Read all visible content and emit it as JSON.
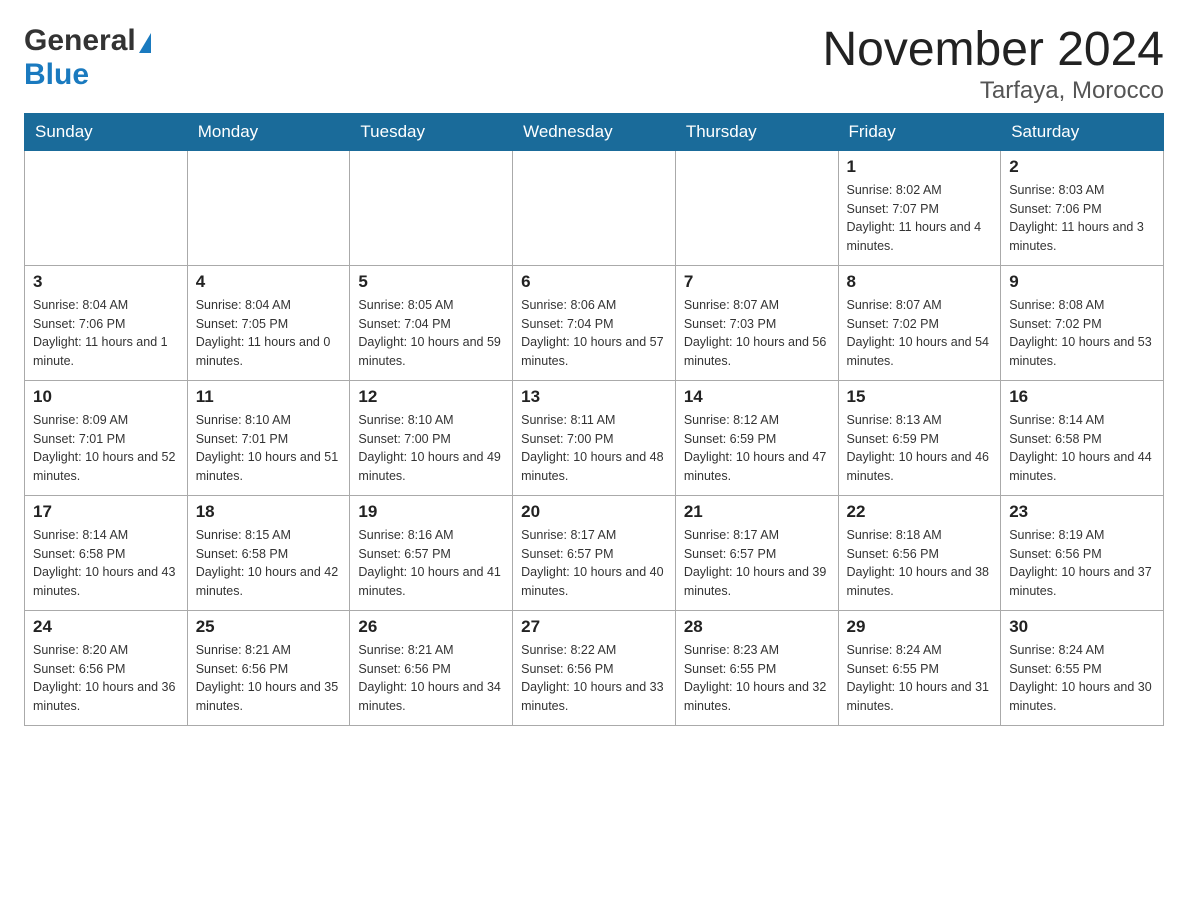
{
  "logo": {
    "general": "General",
    "blue": "Blue"
  },
  "title": {
    "month_year": "November 2024",
    "location": "Tarfaya, Morocco"
  },
  "weekdays": [
    "Sunday",
    "Monday",
    "Tuesday",
    "Wednesday",
    "Thursday",
    "Friday",
    "Saturday"
  ],
  "weeks": [
    {
      "days": [
        {
          "number": "",
          "info": ""
        },
        {
          "number": "",
          "info": ""
        },
        {
          "number": "",
          "info": ""
        },
        {
          "number": "",
          "info": ""
        },
        {
          "number": "",
          "info": ""
        },
        {
          "number": "1",
          "info": "Sunrise: 8:02 AM\nSunset: 7:07 PM\nDaylight: 11 hours and 4 minutes."
        },
        {
          "number": "2",
          "info": "Sunrise: 8:03 AM\nSunset: 7:06 PM\nDaylight: 11 hours and 3 minutes."
        }
      ]
    },
    {
      "days": [
        {
          "number": "3",
          "info": "Sunrise: 8:04 AM\nSunset: 7:06 PM\nDaylight: 11 hours and 1 minute."
        },
        {
          "number": "4",
          "info": "Sunrise: 8:04 AM\nSunset: 7:05 PM\nDaylight: 11 hours and 0 minutes."
        },
        {
          "number": "5",
          "info": "Sunrise: 8:05 AM\nSunset: 7:04 PM\nDaylight: 10 hours and 59 minutes."
        },
        {
          "number": "6",
          "info": "Sunrise: 8:06 AM\nSunset: 7:04 PM\nDaylight: 10 hours and 57 minutes."
        },
        {
          "number": "7",
          "info": "Sunrise: 8:07 AM\nSunset: 7:03 PM\nDaylight: 10 hours and 56 minutes."
        },
        {
          "number": "8",
          "info": "Sunrise: 8:07 AM\nSunset: 7:02 PM\nDaylight: 10 hours and 54 minutes."
        },
        {
          "number": "9",
          "info": "Sunrise: 8:08 AM\nSunset: 7:02 PM\nDaylight: 10 hours and 53 minutes."
        }
      ]
    },
    {
      "days": [
        {
          "number": "10",
          "info": "Sunrise: 8:09 AM\nSunset: 7:01 PM\nDaylight: 10 hours and 52 minutes."
        },
        {
          "number": "11",
          "info": "Sunrise: 8:10 AM\nSunset: 7:01 PM\nDaylight: 10 hours and 51 minutes."
        },
        {
          "number": "12",
          "info": "Sunrise: 8:10 AM\nSunset: 7:00 PM\nDaylight: 10 hours and 49 minutes."
        },
        {
          "number": "13",
          "info": "Sunrise: 8:11 AM\nSunset: 7:00 PM\nDaylight: 10 hours and 48 minutes."
        },
        {
          "number": "14",
          "info": "Sunrise: 8:12 AM\nSunset: 6:59 PM\nDaylight: 10 hours and 47 minutes."
        },
        {
          "number": "15",
          "info": "Sunrise: 8:13 AM\nSunset: 6:59 PM\nDaylight: 10 hours and 46 minutes."
        },
        {
          "number": "16",
          "info": "Sunrise: 8:14 AM\nSunset: 6:58 PM\nDaylight: 10 hours and 44 minutes."
        }
      ]
    },
    {
      "days": [
        {
          "number": "17",
          "info": "Sunrise: 8:14 AM\nSunset: 6:58 PM\nDaylight: 10 hours and 43 minutes."
        },
        {
          "number": "18",
          "info": "Sunrise: 8:15 AM\nSunset: 6:58 PM\nDaylight: 10 hours and 42 minutes."
        },
        {
          "number": "19",
          "info": "Sunrise: 8:16 AM\nSunset: 6:57 PM\nDaylight: 10 hours and 41 minutes."
        },
        {
          "number": "20",
          "info": "Sunrise: 8:17 AM\nSunset: 6:57 PM\nDaylight: 10 hours and 40 minutes."
        },
        {
          "number": "21",
          "info": "Sunrise: 8:17 AM\nSunset: 6:57 PM\nDaylight: 10 hours and 39 minutes."
        },
        {
          "number": "22",
          "info": "Sunrise: 8:18 AM\nSunset: 6:56 PM\nDaylight: 10 hours and 38 minutes."
        },
        {
          "number": "23",
          "info": "Sunrise: 8:19 AM\nSunset: 6:56 PM\nDaylight: 10 hours and 37 minutes."
        }
      ]
    },
    {
      "days": [
        {
          "number": "24",
          "info": "Sunrise: 8:20 AM\nSunset: 6:56 PM\nDaylight: 10 hours and 36 minutes."
        },
        {
          "number": "25",
          "info": "Sunrise: 8:21 AM\nSunset: 6:56 PM\nDaylight: 10 hours and 35 minutes."
        },
        {
          "number": "26",
          "info": "Sunrise: 8:21 AM\nSunset: 6:56 PM\nDaylight: 10 hours and 34 minutes."
        },
        {
          "number": "27",
          "info": "Sunrise: 8:22 AM\nSunset: 6:56 PM\nDaylight: 10 hours and 33 minutes."
        },
        {
          "number": "28",
          "info": "Sunrise: 8:23 AM\nSunset: 6:55 PM\nDaylight: 10 hours and 32 minutes."
        },
        {
          "number": "29",
          "info": "Sunrise: 8:24 AM\nSunset: 6:55 PM\nDaylight: 10 hours and 31 minutes."
        },
        {
          "number": "30",
          "info": "Sunrise: 8:24 AM\nSunset: 6:55 PM\nDaylight: 10 hours and 30 minutes."
        }
      ]
    }
  ]
}
